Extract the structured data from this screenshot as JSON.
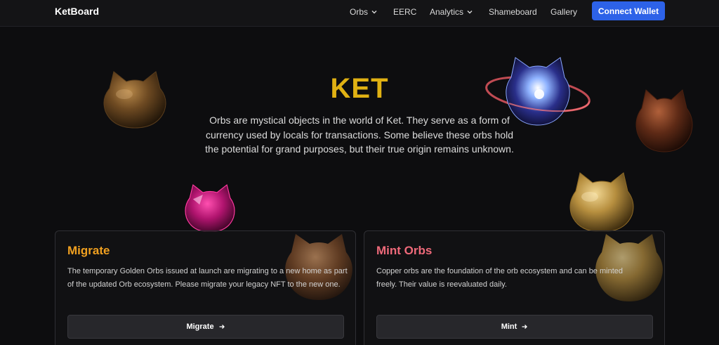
{
  "nav": {
    "brand": "KetBoard",
    "items": [
      {
        "label": "Orbs",
        "has_dropdown": true
      },
      {
        "label": "EERC",
        "has_dropdown": false
      },
      {
        "label": "Analytics",
        "has_dropdown": true
      },
      {
        "label": "Shameboard",
        "has_dropdown": false
      },
      {
        "label": "Gallery",
        "has_dropdown": false
      }
    ],
    "connect_label": "Connect Wallet"
  },
  "hero": {
    "title": "KET",
    "description": "Orbs are mystical objects in the world of Ket. They serve as a form of currency used by locals for transactions. Some believe these orbs hold the potential for grand purposes, but their true origin remains unknown."
  },
  "cards": [
    {
      "title": "Migrate",
      "title_color": "#f0a020",
      "text": "The temporary Golden Orbs issued at launch are migrating to a new home as part of the updated Orb ecosystem. Please migrate your legacy NFT to the new one.",
      "button_label": "Migrate"
    },
    {
      "title": "Mint Orbs",
      "title_color": "#ef6a7a",
      "text": "Copper orbs are the foundation of the orb ecosystem and can be minted freely. Their value is reevaluated daily.",
      "button_label": "Mint"
    }
  ],
  "colors": {
    "background": "#0d0d0f",
    "accent": "#2d62e8",
    "ket_gold": "#e0b113"
  },
  "decorative_orbs": [
    "bronze-orb",
    "galaxy-orb",
    "copper-orb",
    "magenta-orb",
    "gold-orb",
    "brown-orb"
  ]
}
